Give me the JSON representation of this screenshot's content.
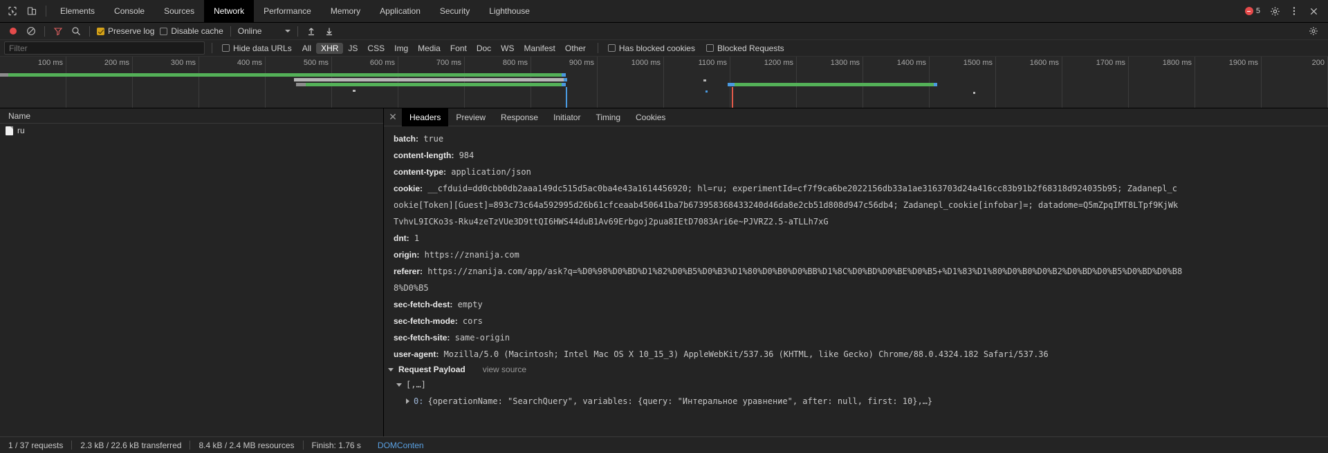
{
  "devtools": {
    "tabs": [
      {
        "label": "Elements",
        "active": false
      },
      {
        "label": "Console",
        "active": false
      },
      {
        "label": "Sources",
        "active": false
      },
      {
        "label": "Network",
        "active": true
      },
      {
        "label": "Performance",
        "active": false
      },
      {
        "label": "Memory",
        "active": false
      },
      {
        "label": "Application",
        "active": false
      },
      {
        "label": "Security",
        "active": false
      },
      {
        "label": "Lighthouse",
        "active": false
      }
    ],
    "error_count": "5"
  },
  "toolbar": {
    "preserve_log_label": "Preserve log",
    "preserve_log_checked": true,
    "disable_cache_label": "Disable cache",
    "disable_cache_checked": false,
    "throttle_value": "Online"
  },
  "filterbar": {
    "filter_placeholder": "Filter",
    "filter_value": "",
    "hide_data_urls_label": "Hide data URLs",
    "hide_data_urls_checked": false,
    "types": [
      {
        "label": "All",
        "active": false
      },
      {
        "label": "XHR",
        "active": true
      },
      {
        "label": "JS",
        "active": false
      },
      {
        "label": "CSS",
        "active": false
      },
      {
        "label": "Img",
        "active": false
      },
      {
        "label": "Media",
        "active": false
      },
      {
        "label": "Font",
        "active": false
      },
      {
        "label": "Doc",
        "active": false
      },
      {
        "label": "WS",
        "active": false
      },
      {
        "label": "Manifest",
        "active": false
      },
      {
        "label": "Other",
        "active": false
      }
    ],
    "has_blocked_cookies_label": "Has blocked cookies",
    "has_blocked_cookies_checked": false,
    "blocked_requests_label": "Blocked Requests",
    "blocked_requests_checked": false
  },
  "overview": {
    "ticks": [
      "100 ms",
      "200 ms",
      "300 ms",
      "400 ms",
      "500 ms",
      "600 ms",
      "700 ms",
      "800 ms",
      "900 ms",
      "1000 ms",
      "1100 ms",
      "1200 ms",
      "1300 ms",
      "1400 ms",
      "1500 ms",
      "1600 ms",
      "1700 ms",
      "1800 ms",
      "1900 ms",
      "200"
    ]
  },
  "request_list": {
    "column_name": "Name",
    "rows": [
      {
        "name": "ru"
      }
    ]
  },
  "detail": {
    "tabs": [
      {
        "label": "Headers",
        "active": true
      },
      {
        "label": "Preview",
        "active": false
      },
      {
        "label": "Response",
        "active": false
      },
      {
        "label": "Initiator",
        "active": false
      },
      {
        "label": "Timing",
        "active": false
      },
      {
        "label": "Cookies",
        "active": false
      }
    ],
    "headers": [
      {
        "name": "batch:",
        "value": "true"
      },
      {
        "name": "content-length:",
        "value": "984"
      },
      {
        "name": "content-type:",
        "value": "application/json"
      },
      {
        "name": "cookie:",
        "value": "__cfduid=dd0cbb0db2aaa149dc515d5ac0ba4e43a1614456920; hl=ru; experimentId=cf7f9ca6be2022156db33a1ae3163703d24a416cc83b91b2f68318d924035b95; Zadanepl_c"
      },
      {
        "name": "",
        "value": "ookie[Token][Guest]=893c73c64a592995d26b61cfceaab450641ba7b673958368433240d46da8e2cb51d808d947c56db4; Zadanepl_cookie[infobar]=; datadome=Q5mZpqIMT8LTpf9KjWk"
      },
      {
        "name": "",
        "value": "TvhvL9ICKo3s-Rku4zeTzVUe3D9ttQI6HWS44duB1Av69Erbgoj2pua8IEtD7083Ari6e~PJVRZ2.5-aTLLh7xG"
      },
      {
        "name": "dnt:",
        "value": "1"
      },
      {
        "name": "origin:",
        "value": "https://znanija.com"
      },
      {
        "name": "referer:",
        "value": "https://znanija.com/app/ask?q=%D0%98%D0%BD%D1%82%D0%B5%D0%B3%D1%80%D0%B0%D0%BB%D1%8C%D0%BD%D0%BE%D0%B5+%D1%83%D1%80%D0%B0%D0%B2%D0%BD%D0%B5%D0%BD%D0%B8"
      },
      {
        "name": "",
        "value": "8%D0%B5"
      },
      {
        "name": "sec-fetch-dest:",
        "value": "empty"
      },
      {
        "name": "sec-fetch-mode:",
        "value": "cors"
      },
      {
        "name": "sec-fetch-site:",
        "value": "same-origin"
      },
      {
        "name": "user-agent:",
        "value": "Mozilla/5.0 (Macintosh; Intel Mac OS X 10_15_3) AppleWebKit/537.36 (KHTML, like Gecko) Chrome/88.0.4324.182 Safari/537.36"
      }
    ],
    "request_payload": {
      "title": "Request Payload",
      "view_source_label": "view source",
      "root": "[,…]",
      "entry_key": "0:",
      "entry_value": "{operationName: \"SearchQuery\", variables: {query: \"Интеральное уравнение\", after: null, first: 10},…}"
    }
  },
  "statusbar": {
    "requests": "1 / 37 requests",
    "transferred": "2.3 kB / 22.6 kB transferred",
    "resources": "8.4 kB / 2.4 MB resources",
    "finish": "Finish: 1.76 s",
    "domcontent": "DOMConten"
  },
  "colors": {
    "accent_green": "#54b158",
    "accent_blue": "#4a9ae0",
    "accent_red": "#e54b4b",
    "check_yellow": "#d4a119",
    "link_blue": "#5aa1e3"
  }
}
